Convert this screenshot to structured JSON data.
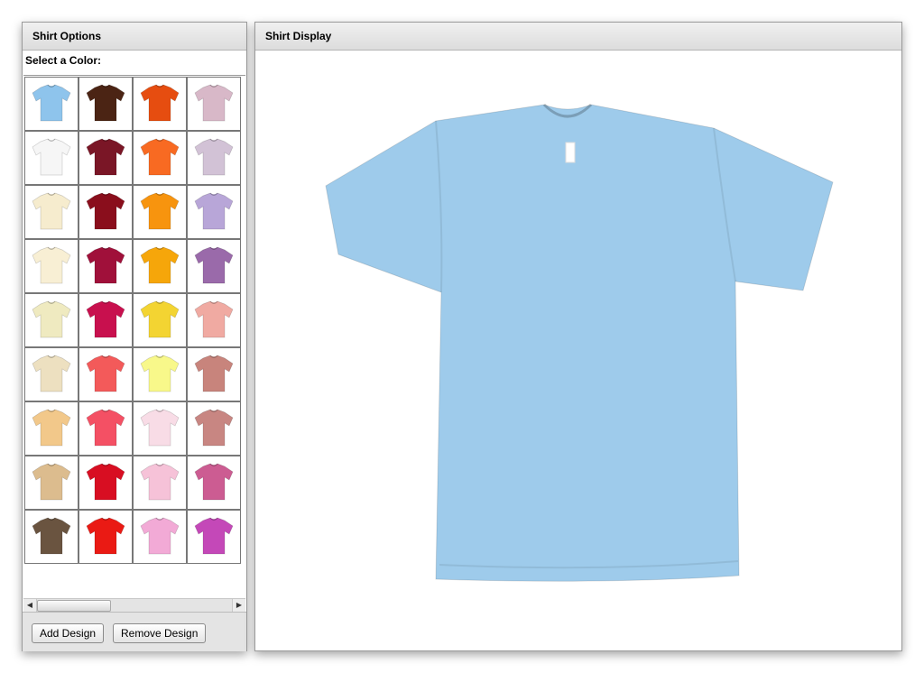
{
  "options_panel": {
    "title": "Shirt Options",
    "select_label": "Select a Color:",
    "add_design_label": "Add Design",
    "remove_design_label": "Remove Design",
    "scroll_position": 0.0
  },
  "display_panel": {
    "title": "Shirt Display",
    "selected_color": "#9ecbeb"
  },
  "swatches": [
    "#8ec4ec",
    "#4b2414",
    "#e64d10",
    "#d8b8c8",
    "#f6f6f6",
    "#7a1626",
    "#f86a22",
    "#d2c2d6",
    "#f6ecce",
    "#8a0e1c",
    "#f7940e",
    "#b8a6d8",
    "#f8efd4",
    "#a0103a",
    "#f6a60a",
    "#9a6aaa",
    "#efeac0",
    "#c8104e",
    "#f3d432",
    "#f0aaa2",
    "#ede0c0",
    "#f35a5a",
    "#f8f88a",
    "#c8847c",
    "#f2c88a",
    "#f45064",
    "#f8dce6",
    "#c88682",
    "#dcbc8e",
    "#d80e22",
    "#f6c2d8",
    "#cc5c92",
    "#6a5440",
    "#ea1a14",
    "#f2aad6",
    "#c448b8"
  ]
}
